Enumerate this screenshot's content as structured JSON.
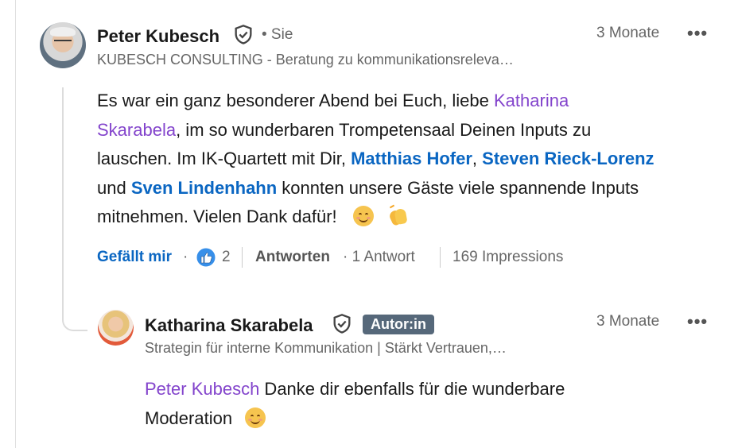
{
  "comment": {
    "author": "Peter Kubesch",
    "you_label": "• Sie",
    "headline": "KUBESCH CONSULTING - Beratung zu kommunikationsreleva…",
    "time": "3 Monate",
    "more": "•••",
    "body": {
      "t1": "Es war ein ganz besonderer Abend bei Euch, liebe ",
      "m1": "Katharina",
      "m1b": "Skarabela",
      "t2": ", im so wunderbaren Trompetensaal Deinen Inputs zu",
      "t3": "lauschen. Im IK-Quartett mit Dir, ",
      "l1": "Matthias Hofer",
      "t4": ", ",
      "l2": "Steven Rieck-Lorenz",
      "t5": " und ",
      "l3": "Sven Lindenhahn",
      "t6": " konnten unsere Gäste viele spannende Inputs",
      "t7": "mitnehmen. Vielen Dank dafür!"
    },
    "actions": {
      "like": "Gefällt mir",
      "dot1": "·",
      "like_count": "2",
      "reply": "Antworten",
      "reply_count": "· 1 Antwort",
      "impressions": "169 Impressions"
    }
  },
  "reply": {
    "author": "Katharina Skarabela",
    "badge": "Autor:in",
    "headline": "Strategin für interne Kommunikation | Stärkt Vertrauen,…",
    "time": "3 Monate",
    "more": "•••",
    "mention": "Peter Kubesch",
    "text1": " Danke dir ebenfalls für die wunderbare",
    "text2": "Moderation"
  },
  "colors": {
    "accent": "#0a66c2",
    "mention": "#8344cc",
    "badge": "#56687a"
  },
  "icons": [
    "verified-shield-icon",
    "like-reaction-icon",
    "smile-emoji-icon",
    "clap-emoji-icon",
    "more-options-icon"
  ]
}
